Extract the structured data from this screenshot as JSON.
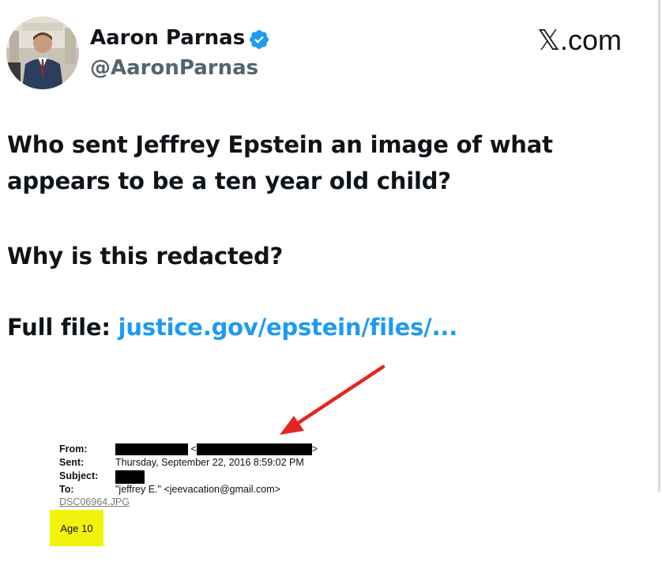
{
  "header": {
    "display_name": "Aaron Parnas",
    "handle": "@AaronParnas",
    "site_x": "𝕏",
    "site_domain": ".com",
    "verified_icon": "verified-badge-icon"
  },
  "tweet": {
    "line1": "Who sent Jeffrey Epstein an image of what",
    "line2": "appears to be a ten year old child?",
    "line3": "Why is this redacted?",
    "link_prefix": "Full file: ",
    "link_text": "justice.gov/epstein/files/..."
  },
  "email_doc": {
    "from_label": "From:",
    "sent_label": "Sent:",
    "sent_value": "Thursday, September 22, 2016 8:59:02 PM",
    "subject_label": "Subject:",
    "to_label": "To:",
    "to_value": "\"jeffrey E.\" <jeevacation@gmail.com>",
    "attachment": "DSC06964.JPG",
    "lt": "<",
    "gt": ">"
  },
  "annotation": {
    "age_note": "Age 10",
    "arrow_color": "#e3261f"
  },
  "colors": {
    "link": "#1d9bf0",
    "verified": "#1d9bf0",
    "highlight": "#f2f20c"
  }
}
